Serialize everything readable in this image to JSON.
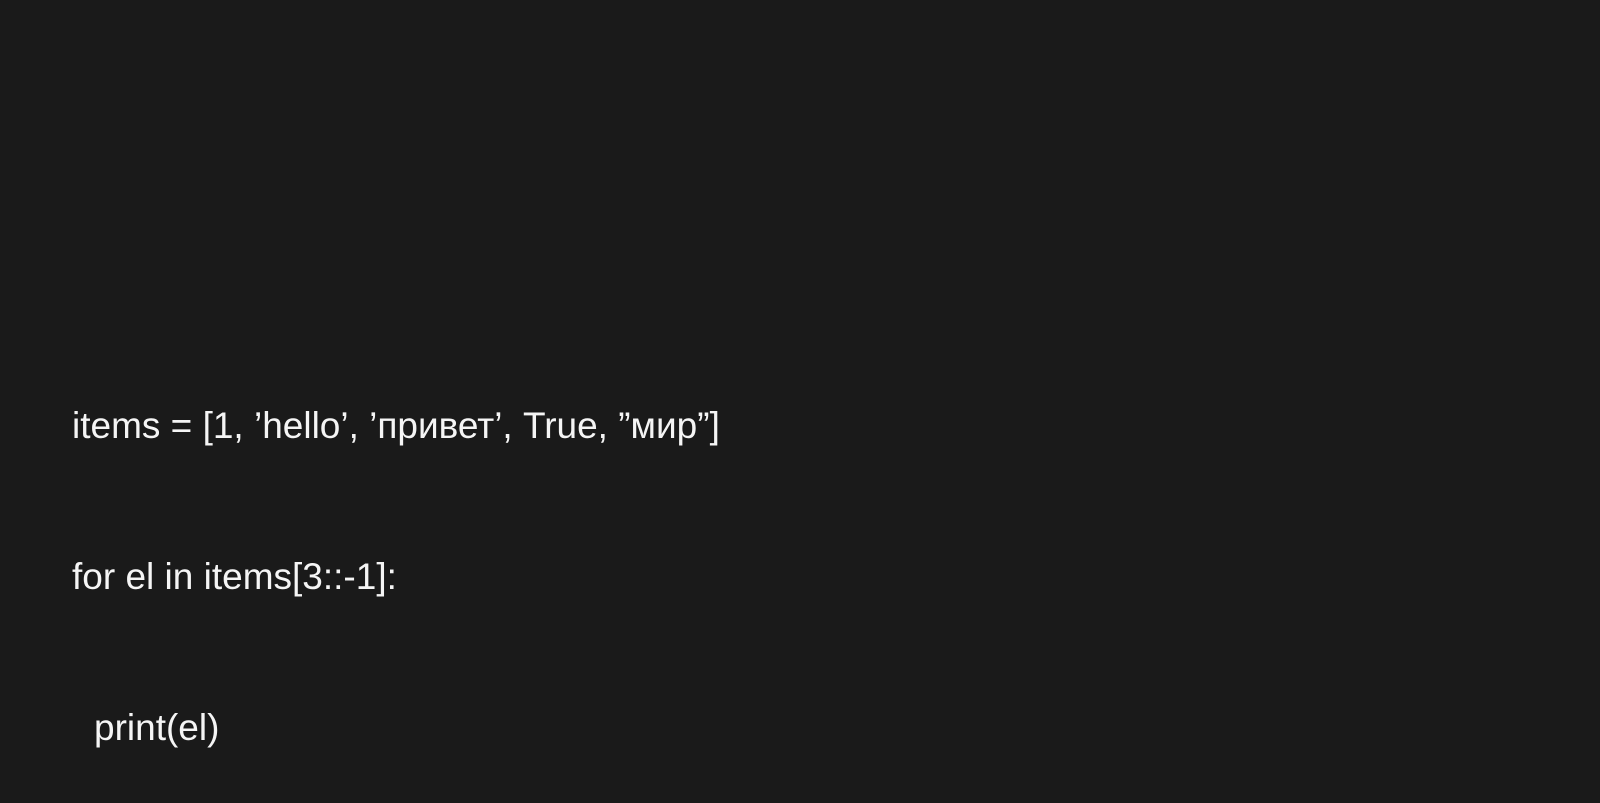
{
  "code": {
    "line1": "items = [1, ’hello’, ’привет’, True, ”мир”]",
    "line2": "for el in items[3::-1]:",
    "line3": "print(el)"
  }
}
